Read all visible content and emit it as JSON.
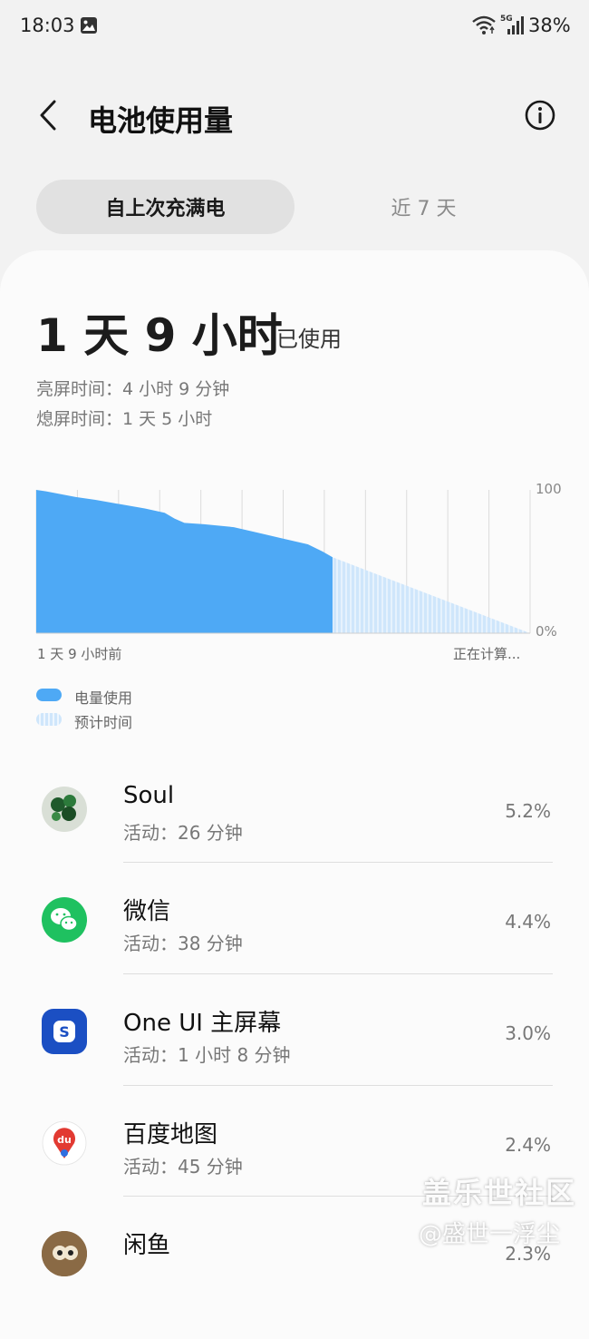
{
  "status_bar": {
    "time": "18:03",
    "battery": "38%",
    "network_badge": "5G"
  },
  "header": {
    "title": "电池使用量",
    "back_icon": "chevron-left-icon",
    "info_icon": "info-circle-icon"
  },
  "tabs": [
    {
      "label": "自上次充满电",
      "selected": true
    },
    {
      "label": "近 7 天",
      "selected": false
    }
  ],
  "summary": {
    "used_time": "1 天 9 小时",
    "used_suffix": "已使用",
    "screen_on": "亮屏时间：4 小时 9 分钟",
    "screen_off": "熄屏时间：1 天 5 小时"
  },
  "chart_data": {
    "type": "area",
    "x_start_label": "1 天 9 小时前",
    "x_end_label": "正在计算...",
    "y_ticks": [
      "100",
      "0%"
    ],
    "ylim": [
      0,
      100
    ],
    "used": [
      [
        0,
        100
      ],
      [
        2,
        99
      ],
      [
        5,
        97
      ],
      [
        8,
        95
      ],
      [
        12,
        93
      ],
      [
        17,
        90
      ],
      [
        22,
        87
      ],
      [
        26,
        84
      ],
      [
        28,
        80
      ],
      [
        30,
        77
      ],
      [
        34,
        76
      ],
      [
        40,
        74
      ],
      [
        45,
        70
      ],
      [
        50,
        66
      ],
      [
        55,
        62
      ],
      [
        58,
        57
      ],
      [
        60,
        53
      ]
    ],
    "predicted": [
      [
        60,
        53
      ],
      [
        100,
        0
      ]
    ],
    "colors": {
      "used": "#4ea9f5",
      "predicted": "#cfe6fb",
      "grid": "#dcdcdc"
    }
  },
  "legend": [
    {
      "label": "电量使用",
      "color": "#4ea9f5"
    },
    {
      "label": "预计时间",
      "color": "#cfe6fb"
    }
  ],
  "apps": [
    {
      "name": "Soul",
      "detail": "活动：26 分钟",
      "percent": "5.2%",
      "icon": "soul-app-icon"
    },
    {
      "name": "微信",
      "detail": "活动：38 分钟",
      "percent": "4.4%",
      "icon": "wechat-app-icon"
    },
    {
      "name": "One UI 主屏幕",
      "detail": "活动：1 小时 8 分钟",
      "percent": "3.0%",
      "icon": "oneui-home-app-icon"
    },
    {
      "name": "百度地图",
      "detail": "活动：45 分钟",
      "percent": "2.4%",
      "icon": "baidu-map-app-icon",
      "icon_text": "du"
    },
    {
      "name": "闲鱼",
      "detail": "",
      "percent": "2.3%",
      "icon": "xianyu-app-icon"
    }
  ],
  "watermark": {
    "line1": "盖乐世社区",
    "line2": "@盛世一浮尘"
  }
}
